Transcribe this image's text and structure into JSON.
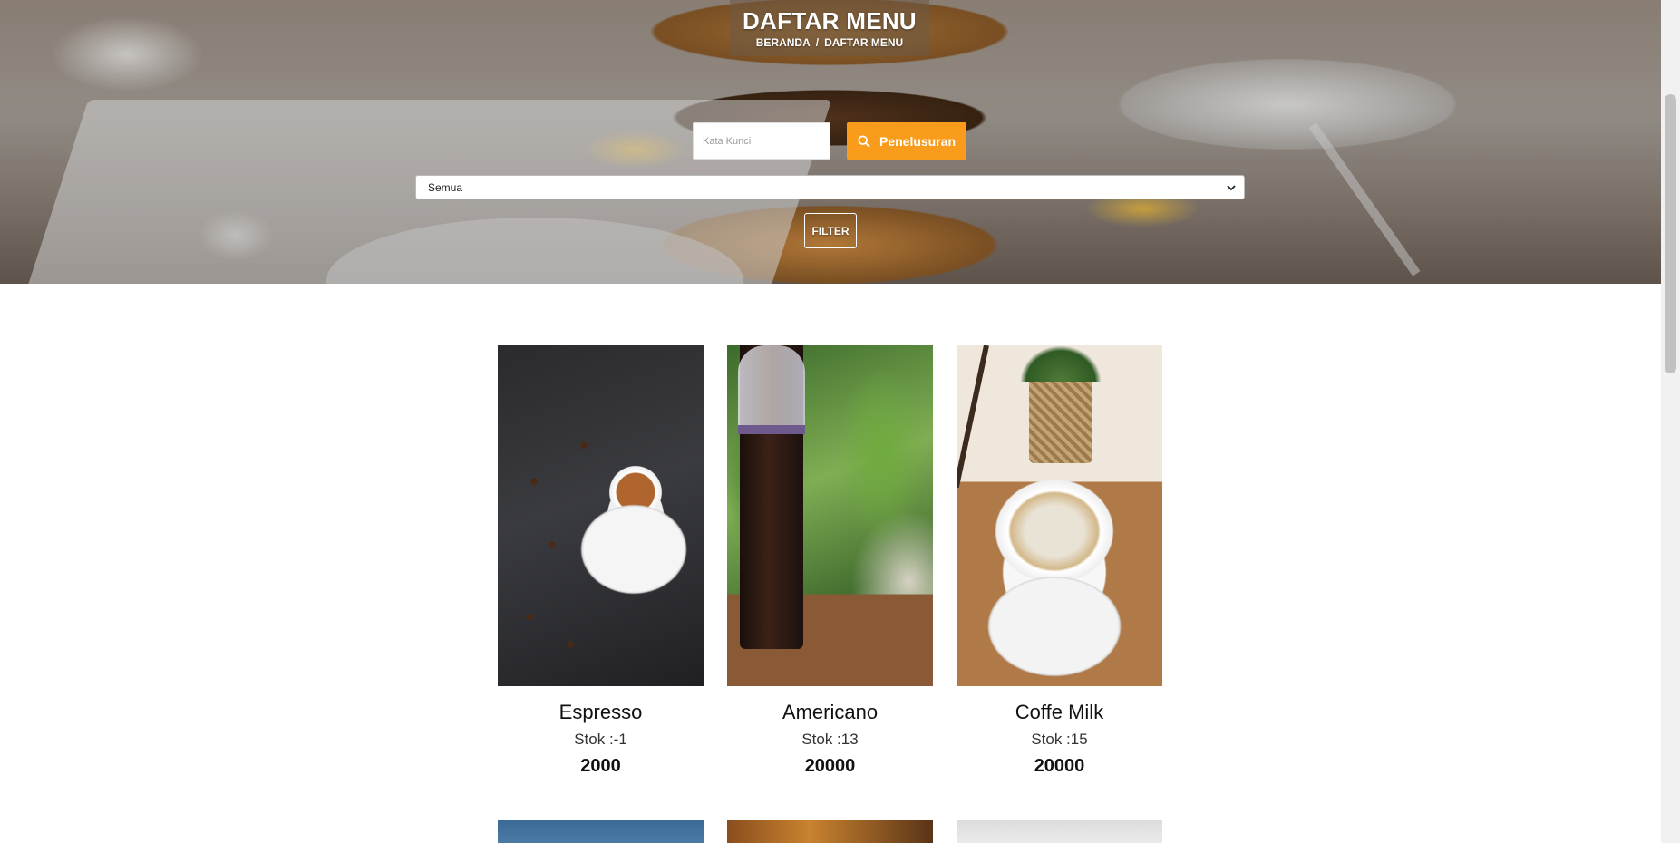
{
  "header": {
    "title": "DAFTAR MENU",
    "breadcrumb": {
      "home": "BERANDA",
      "separator": "/",
      "current": "DAFTAR MENU"
    }
  },
  "search": {
    "placeholder": "Kata Kunci",
    "value": "",
    "button_label": "Penelusuran",
    "button_color": "#f99c1c"
  },
  "filter": {
    "category_selected": "Semua",
    "button_label": "FILTER"
  },
  "menu_items": [
    {
      "name": "Espresso",
      "stock": "Stok :-1",
      "price": "2000",
      "image": "espresso-photo"
    },
    {
      "name": "Americano",
      "stock": "Stok :13",
      "price": "20000",
      "image": "americano-photo"
    },
    {
      "name": "Coffe Milk",
      "stock": "Stok :15",
      "price": "20000",
      "image": "coffee-milk-photo"
    }
  ]
}
